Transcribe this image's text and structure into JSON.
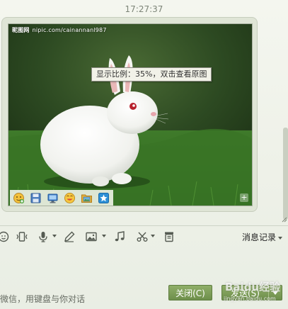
{
  "chat": {
    "timestamp": "17:27:37"
  },
  "image_message": {
    "watermark_logo": "昵图网",
    "watermark_url": "nipic.com/cainannanl987",
    "scale_tooltip": "显示比例：35%，双击查看原图",
    "tools": [
      {
        "name": "emoji-add-icon"
      },
      {
        "name": "save-icon"
      },
      {
        "name": "screen-icon"
      },
      {
        "name": "smiley-icon"
      },
      {
        "name": "folder-image-icon"
      },
      {
        "name": "pin-icon"
      }
    ],
    "expand_symbol": "+"
  },
  "toolbar": {
    "icons": [
      "smiley-icon",
      "shake-icon",
      "voice-icon",
      "pen-icon",
      "image-icon",
      "music-icon",
      "scissors-icon",
      "trash-icon"
    ],
    "history_label": "消息记录"
  },
  "input": {
    "hint": "微信，用键盘与你对话"
  },
  "actions": {
    "close_label": "关闭(C)",
    "send_label": "发送(S)"
  },
  "overlay": {
    "baidu_brand": "Baidu经验",
    "baidu_url": "jingyan.baidu.com"
  },
  "colors": {
    "accent_button": "#7a9a55",
    "bubble_bg": "#dfe5d6",
    "window_bg": "#f0f3eb"
  }
}
